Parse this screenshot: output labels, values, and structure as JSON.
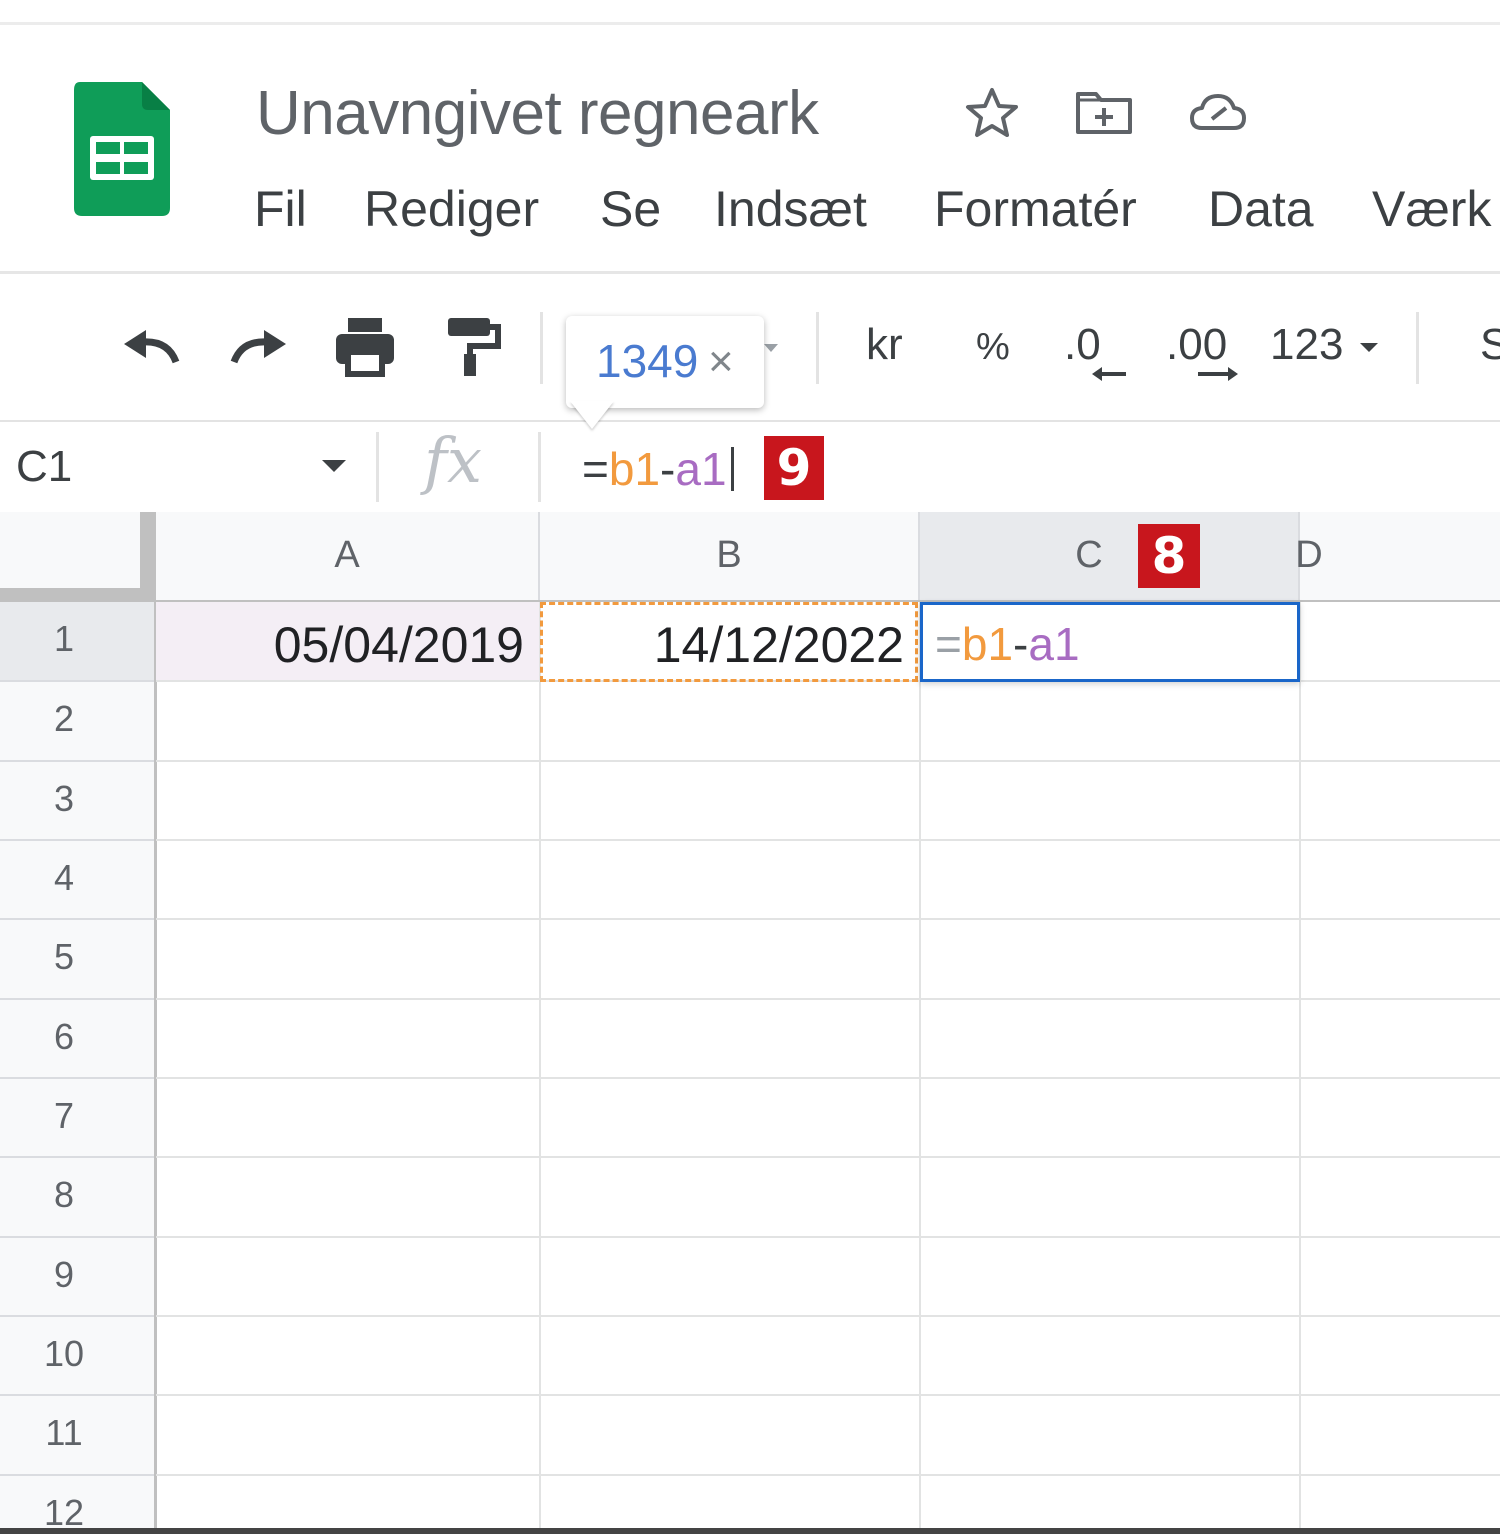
{
  "doc_title": "Unavngivet regneark",
  "menu": [
    "Fil",
    "Rediger",
    "Se",
    "Indsæt",
    "Formatér",
    "Data",
    "Værk"
  ],
  "toolbar": {
    "currency_label": "kr",
    "percent_label": "%",
    "decrease_decimals_label": ".0",
    "increase_decimals_label": ".00",
    "more_formats_label": "123",
    "clipped_label": "S"
  },
  "tooltip": {
    "value": "1349",
    "close_symbol": "×"
  },
  "formula_bar": {
    "name_box": "C1",
    "fx_label": "fx",
    "formula": {
      "eq": "=",
      "ref1": "b1",
      "op": "-",
      "ref2": "a1"
    }
  },
  "badges": {
    "formula": "9",
    "column_c": "8"
  },
  "columns": [
    "A",
    "B",
    "C",
    "D"
  ],
  "rows": [
    "1",
    "2",
    "3",
    "4",
    "5",
    "6",
    "7",
    "8",
    "9",
    "10",
    "11",
    "12"
  ],
  "cells": {
    "A1": "05/04/2019",
    "B1": "14/12/2022",
    "C1": {
      "eq": "=",
      "ref1": "b1",
      "op": "-",
      "ref2": "a1"
    }
  },
  "colors": {
    "ref_b1": "#f29a3e",
    "ref_a1": "#a86cc2",
    "active_border": "#1a66c9",
    "badge": "#c8161d",
    "sheets_green": "#0f9d58"
  }
}
